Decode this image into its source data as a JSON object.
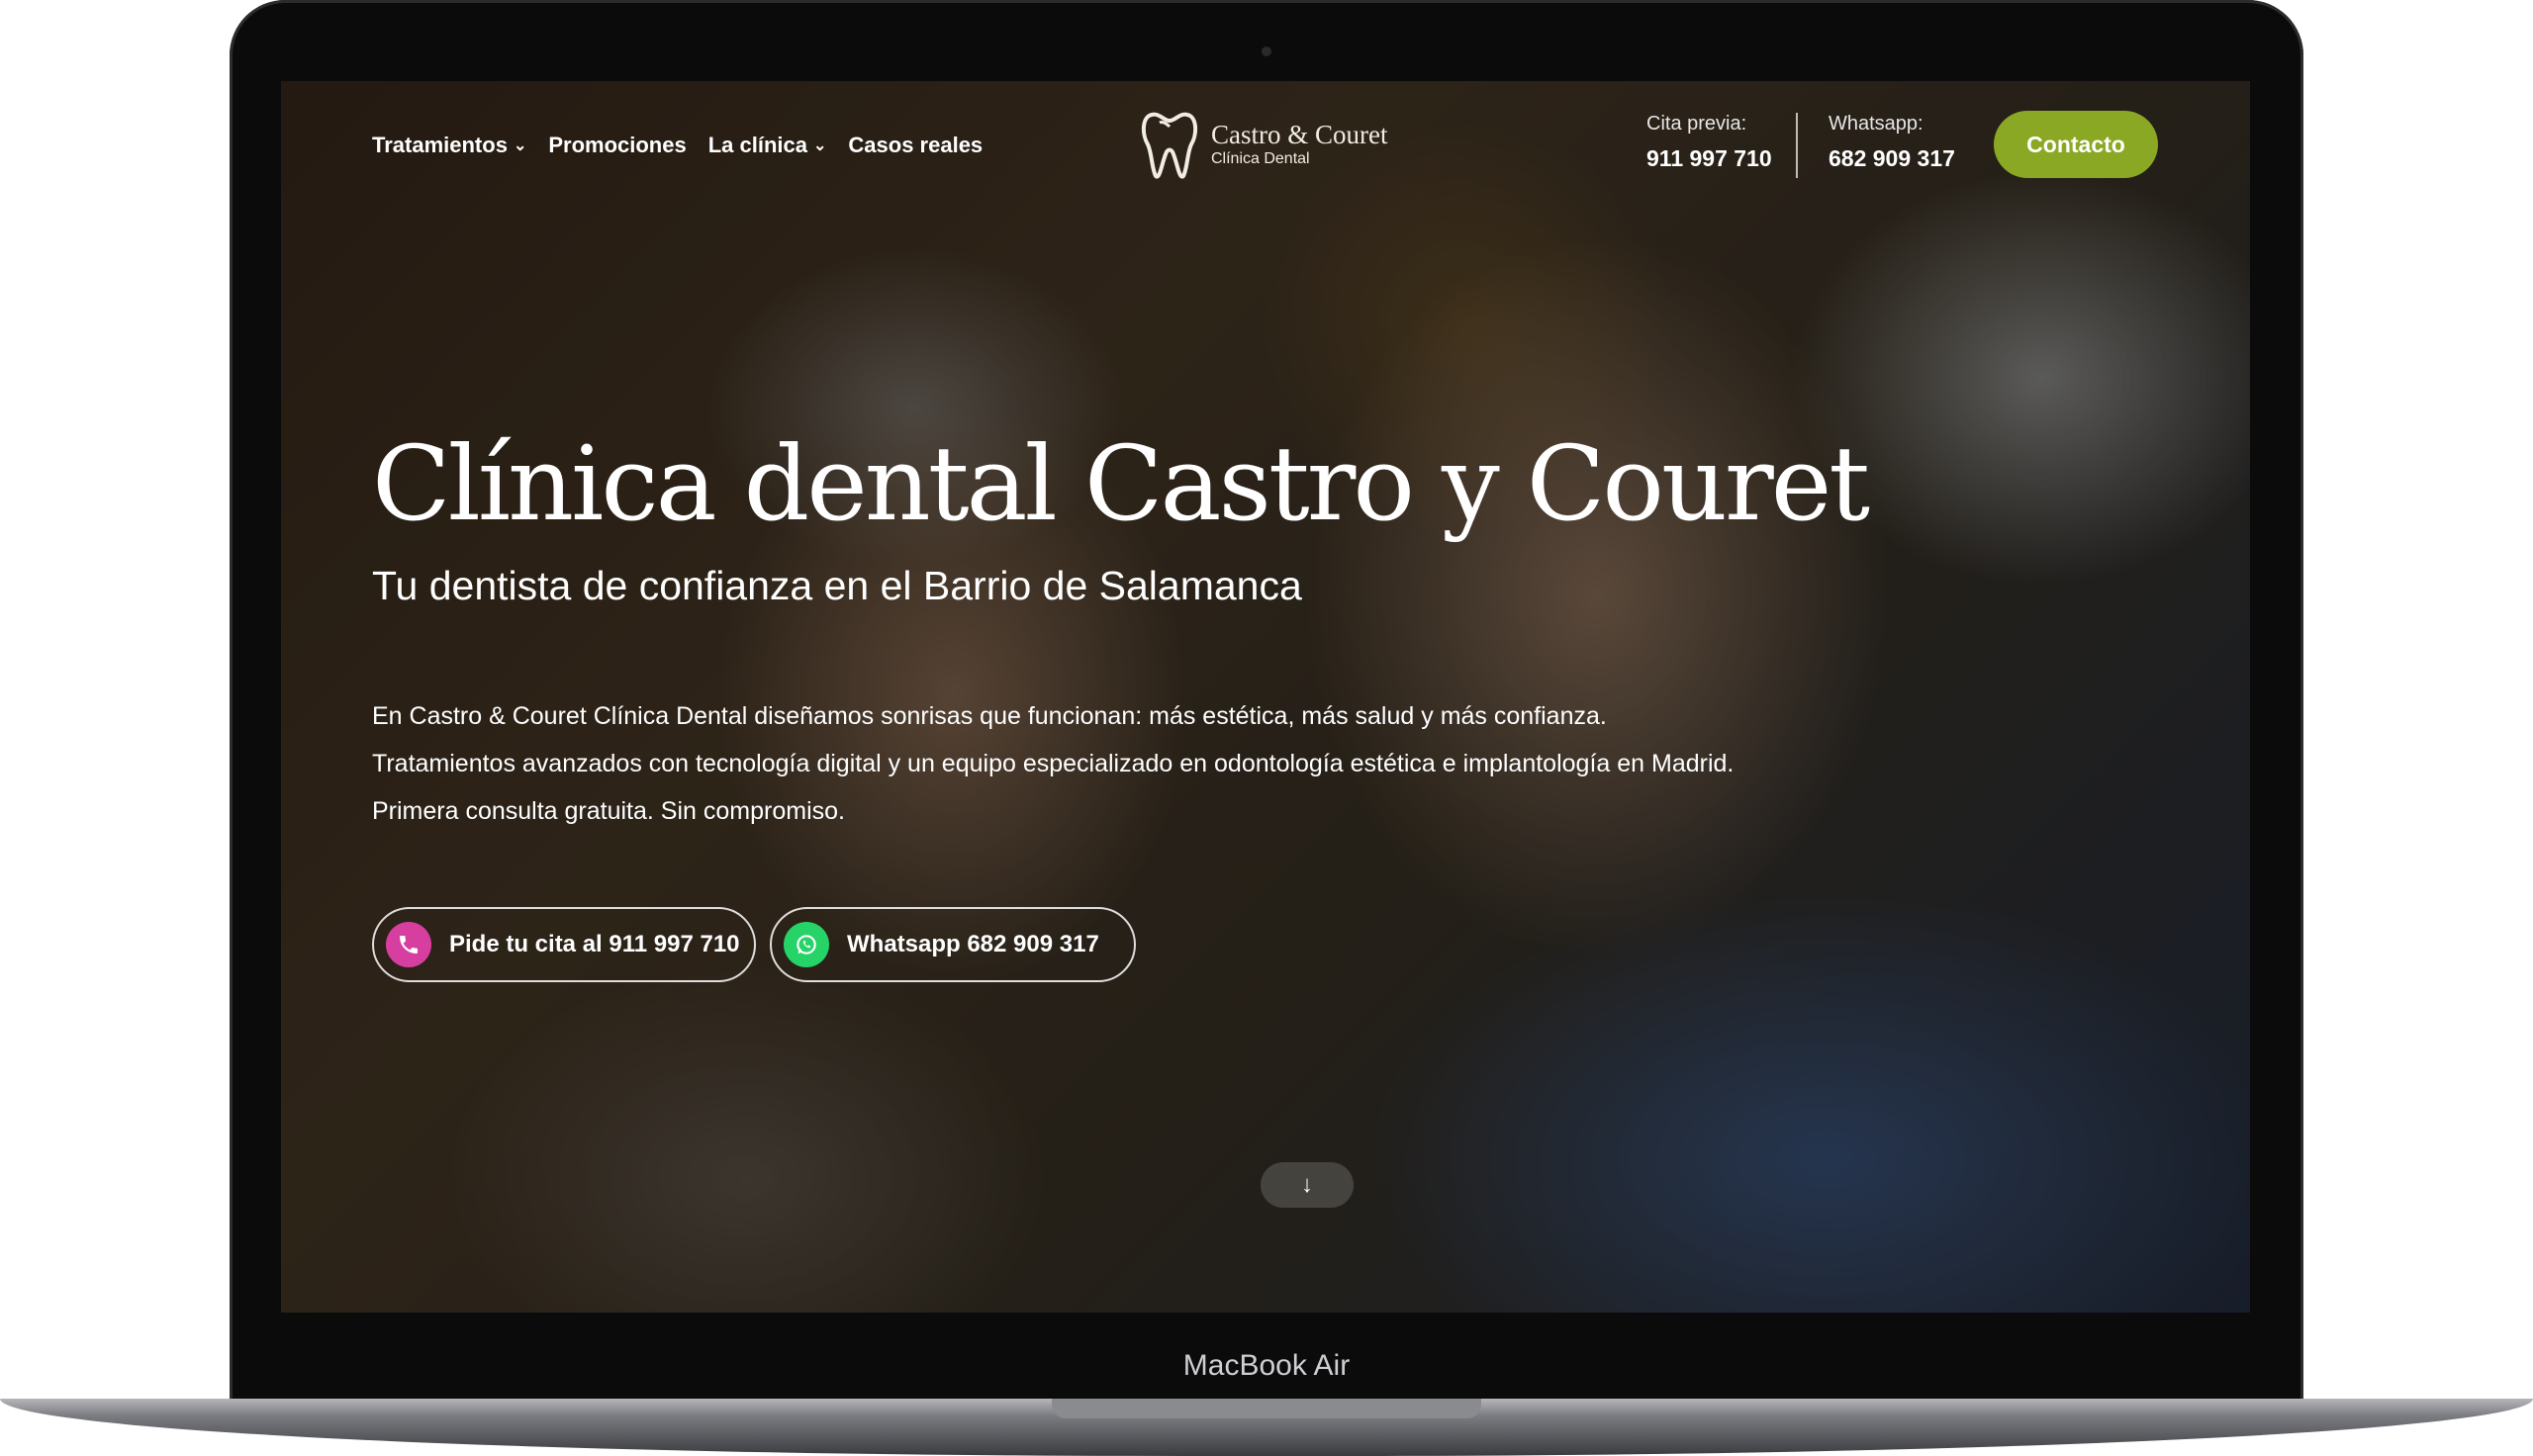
{
  "nav": {
    "items": [
      {
        "label": "Tratamientos",
        "has_dropdown": true
      },
      {
        "label": "Promociones",
        "has_dropdown": false
      },
      {
        "label": "La clínica",
        "has_dropdown": true
      },
      {
        "label": "Casos reales",
        "has_dropdown": false
      }
    ]
  },
  "logo": {
    "name": "Castro & Couret",
    "subtitle": "Clínica Dental",
    "icon": "tooth-icon"
  },
  "contact": {
    "appointment_label": "Cita previa:",
    "appointment_number": "911 997 710",
    "whatsapp_label": "Whatsapp:",
    "whatsapp_number": "682 909 317",
    "button_label": "Contacto",
    "button_color": "#8aa823"
  },
  "hero": {
    "title": "Clínica dental Castro y Couret",
    "subtitle": "Tu dentista de confianza en el Barrio de Salamanca",
    "paragraphs": [
      "En Castro & Couret Clínica Dental diseñamos sonrisas que funcionan: más estética, más salud y más confianza.",
      "Tratamientos avanzados con tecnología digital y un equipo especializado en odontología estética e implantología en Madrid.",
      "Primera consulta gratuita. Sin compromiso."
    ],
    "cta_phone": {
      "label": "Pide tu cita al 911 997 710",
      "icon": "phone-icon",
      "color": "#d63fa0"
    },
    "cta_whatsapp": {
      "label": "Whatsapp 682 909 317",
      "icon": "whatsapp-icon",
      "color": "#25d366"
    },
    "scroll_icon": "arrow-down-icon"
  },
  "device": {
    "label": "MacBook Air"
  }
}
